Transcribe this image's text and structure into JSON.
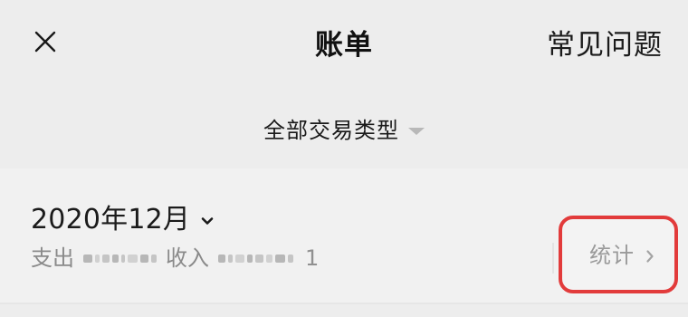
{
  "header": {
    "title": "账单",
    "right_link": "常见问题"
  },
  "filter": {
    "label": "全部交易类型"
  },
  "month": {
    "label": "2020年12月"
  },
  "summary": {
    "expense_label": "支出",
    "income_label": "收入",
    "income_visible_tail": "1"
  },
  "stats": {
    "label": "统计"
  },
  "icons": {
    "close": "close-icon",
    "filter_caret": "caret-down-icon",
    "month_chevron": "chevron-down-icon",
    "stats_chevron": "chevron-right-icon"
  },
  "colors": {
    "highlight_border": "#e23b3b",
    "background": "#ededed",
    "muted_text": "#8a8a8a"
  }
}
